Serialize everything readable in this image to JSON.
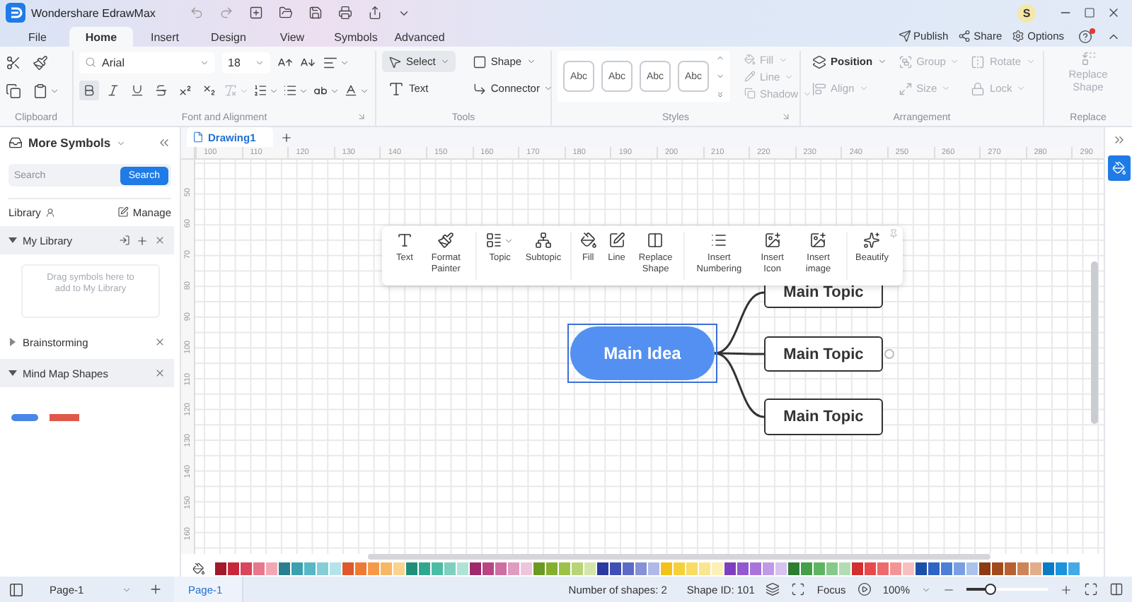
{
  "title_bar": {
    "app_name": "Wondershare EdrawMax",
    "avatar": "S"
  },
  "menu_tabs": [
    {
      "label": "File",
      "selected": false
    },
    {
      "label": "Home",
      "selected": true
    },
    {
      "label": "Insert",
      "selected": false
    },
    {
      "label": "Design",
      "selected": false
    },
    {
      "label": "View",
      "selected": false
    },
    {
      "label": "Symbols",
      "selected": false
    },
    {
      "label": "Advanced",
      "selected": false
    }
  ],
  "header_actions": [
    {
      "label": "Publish"
    },
    {
      "label": "Share"
    },
    {
      "label": "Options"
    }
  ],
  "ribbon": {
    "clipboard": {
      "label": "Clipboard"
    },
    "font": {
      "label": "Font and Alignment",
      "font_name": "Arial",
      "font_size": "18",
      "format_buttons": [
        {
          "selected": true
        },
        {
          "selected": false
        },
        {
          "selected": false
        },
        {
          "selected": false
        },
        {
          "selected": false
        },
        {
          "selected": false
        }
      ],
      "clear_format": {
        "disabled": true
      }
    },
    "tools": {
      "label": "Tools",
      "items": [
        {
          "label": "Select",
          "selected": true,
          "dropdown": true
        },
        {
          "label": "Shape",
          "selected": false,
          "dropdown": true
        },
        {
          "label": "Text",
          "selected": false,
          "dropdown": false
        },
        {
          "label": "Connector",
          "selected": false,
          "dropdown": true
        }
      ]
    },
    "styles": {
      "label": "Styles",
      "samples": [
        "Abc",
        "Abc",
        "Abc",
        "Abc"
      ],
      "options": [
        {
          "label": "Fill",
          "disabled": true
        },
        {
          "label": "Line",
          "disabled": true
        },
        {
          "label": "Shadow",
          "disabled": true
        }
      ]
    },
    "arrangement": {
      "label": "Arrangement",
      "items": [
        {
          "label": "Position",
          "disabled": false
        },
        {
          "label": "Group",
          "disabled": true
        },
        {
          "label": "Rotate",
          "disabled": true
        },
        {
          "label": "Align",
          "disabled": true
        },
        {
          "label": "Size",
          "disabled": true
        },
        {
          "label": "Lock",
          "disabled": true
        }
      ]
    },
    "replace": {
      "label": "Replace",
      "button": {
        "label": "Replace Shape",
        "disabled": true
      }
    }
  },
  "symbols_panel": {
    "title": "More Symbols",
    "search": {
      "placeholder": "Search",
      "button": "Search"
    },
    "library_label": "Library",
    "manage": "Manage",
    "sections": [
      {
        "title": "My Library",
        "expanded": true,
        "kind": "library",
        "hint": "Drag symbols here to add to My Library"
      },
      {
        "title": "Brainstorming",
        "expanded": false,
        "kind": "category"
      },
      {
        "title": "Mind Map Shapes",
        "expanded": true,
        "kind": "category",
        "thumbnails": [
          {
            "color": "#4a86e8"
          },
          {
            "color": "#e0584a"
          }
        ]
      }
    ]
  },
  "document_tabs": [
    {
      "label": "Drawing1",
      "selected": true
    }
  ],
  "ruler": {
    "horizontal": [
      "100",
      "110",
      "120",
      "130",
      "140",
      "150",
      "160",
      "170",
      "180",
      "190",
      "200",
      "210",
      "220",
      "230",
      "240",
      "250",
      "260",
      "270",
      "280",
      "290"
    ],
    "vertical": [
      "50",
      "60",
      "70",
      "80",
      "90",
      "100",
      "110",
      "120",
      "130",
      "140",
      "150",
      "160"
    ]
  },
  "floating_toolbar": {
    "groups": [
      [
        {
          "label": "Text",
          "dropdown": false
        },
        {
          "label": "Format Painter",
          "dropdown": false
        }
      ],
      [
        {
          "label": "Topic",
          "dropdown": true
        },
        {
          "label": "Subtopic",
          "dropdown": false
        }
      ],
      [
        {
          "label": "Fill",
          "dropdown": false
        },
        {
          "label": "Line",
          "dropdown": false
        },
        {
          "label": "Replace Shape",
          "dropdown": false
        }
      ],
      [
        {
          "label": "Insert Numbering",
          "dropdown": false
        },
        {
          "label": "Insert Icon",
          "dropdown": false
        },
        {
          "label": "Insert image",
          "dropdown": false
        }
      ],
      [
        {
          "label": "Beautify",
          "dropdown": false
        }
      ]
    ]
  },
  "diagram": {
    "central": {
      "label": "Main Idea",
      "selected": true
    },
    "topics": [
      {
        "label": "Main Topic"
      },
      {
        "label": "Main Topic"
      },
      {
        "label": "Main Topic"
      }
    ]
  },
  "palette": [
    {
      "color": "#a3182a"
    },
    {
      "color": "#c62839"
    },
    {
      "color": "#d9455a"
    },
    {
      "color": "#e8788b"
    },
    {
      "color": "#f2a7b3"
    },
    {
      "color": "#2a7f8f"
    },
    {
      "color": "#3ba0b0"
    },
    {
      "color": "#57b8c6"
    },
    {
      "color": "#85ced8"
    },
    {
      "color": "#b5e3ea"
    },
    {
      "color": "#e0592a"
    },
    {
      "color": "#f07a34"
    },
    {
      "color": "#f59a48"
    },
    {
      "color": "#f8b766"
    },
    {
      "color": "#fbd38f"
    },
    {
      "color": "#1f8f7a"
    },
    {
      "color": "#2fa88f"
    },
    {
      "color": "#4cbca4"
    },
    {
      "color": "#7dd0bd"
    },
    {
      "color": "#b0e3d7"
    },
    {
      "color": "#9e2a6b"
    },
    {
      "color": "#b84684"
    },
    {
      "color": "#cf6ea1"
    },
    {
      "color": "#e09bc0"
    },
    {
      "color": "#efc5dc"
    },
    {
      "color": "#6a9a22"
    },
    {
      "color": "#83b02f"
    },
    {
      "color": "#9cc248"
    },
    {
      "color": "#b8d477"
    },
    {
      "color": "#d3e6a8"
    },
    {
      "color": "#2b3aa0"
    },
    {
      "color": "#3f51b5"
    },
    {
      "color": "#5c6bc8"
    },
    {
      "color": "#8591d8"
    },
    {
      "color": "#b0b8e8"
    },
    {
      "color": "#f2c21b"
    },
    {
      "color": "#f6d03c"
    },
    {
      "color": "#f8dc64"
    },
    {
      "color": "#fae68f"
    },
    {
      "color": "#fcf0b8"
    },
    {
      "color": "#7d3fbf"
    },
    {
      "color": "#9358cf"
    },
    {
      "color": "#a874db"
    },
    {
      "color": "#c09ae6"
    },
    {
      "color": "#d8c2f0"
    },
    {
      "color": "#2e7d32"
    },
    {
      "color": "#43a047"
    },
    {
      "color": "#5fb564"
    },
    {
      "color": "#86c98a"
    },
    {
      "color": "#b2ddb4"
    },
    {
      "color": "#d32f2f"
    },
    {
      "color": "#e84a4a"
    },
    {
      "color": "#ef6b6b"
    },
    {
      "color": "#f49595"
    },
    {
      "color": "#f8bfbf"
    },
    {
      "color": "#1d4fa8"
    },
    {
      "color": "#2e64c4"
    },
    {
      "color": "#4d7fd6"
    },
    {
      "color": "#7aa0e3"
    },
    {
      "color": "#aac3ee"
    },
    {
      "color": "#8a3b12"
    },
    {
      "color": "#a14a1c"
    },
    {
      "color": "#b8602f"
    },
    {
      "color": "#cf8457"
    },
    {
      "color": "#e3ad8a"
    },
    {
      "color": "#0b7bc8"
    },
    {
      "color": "#1c93dc"
    },
    {
      "color": "#44a9e6"
    }
  ],
  "status_bar": {
    "page_select": "Page-1",
    "page_tabs": [
      {
        "label": "Page-1",
        "selected": true
      }
    ],
    "shape_count": "Number of shapes: 2",
    "shape_id": "Shape ID: 101",
    "focus": "Focus",
    "zoom": {
      "reading": "100%",
      "level": 0.3
    }
  }
}
